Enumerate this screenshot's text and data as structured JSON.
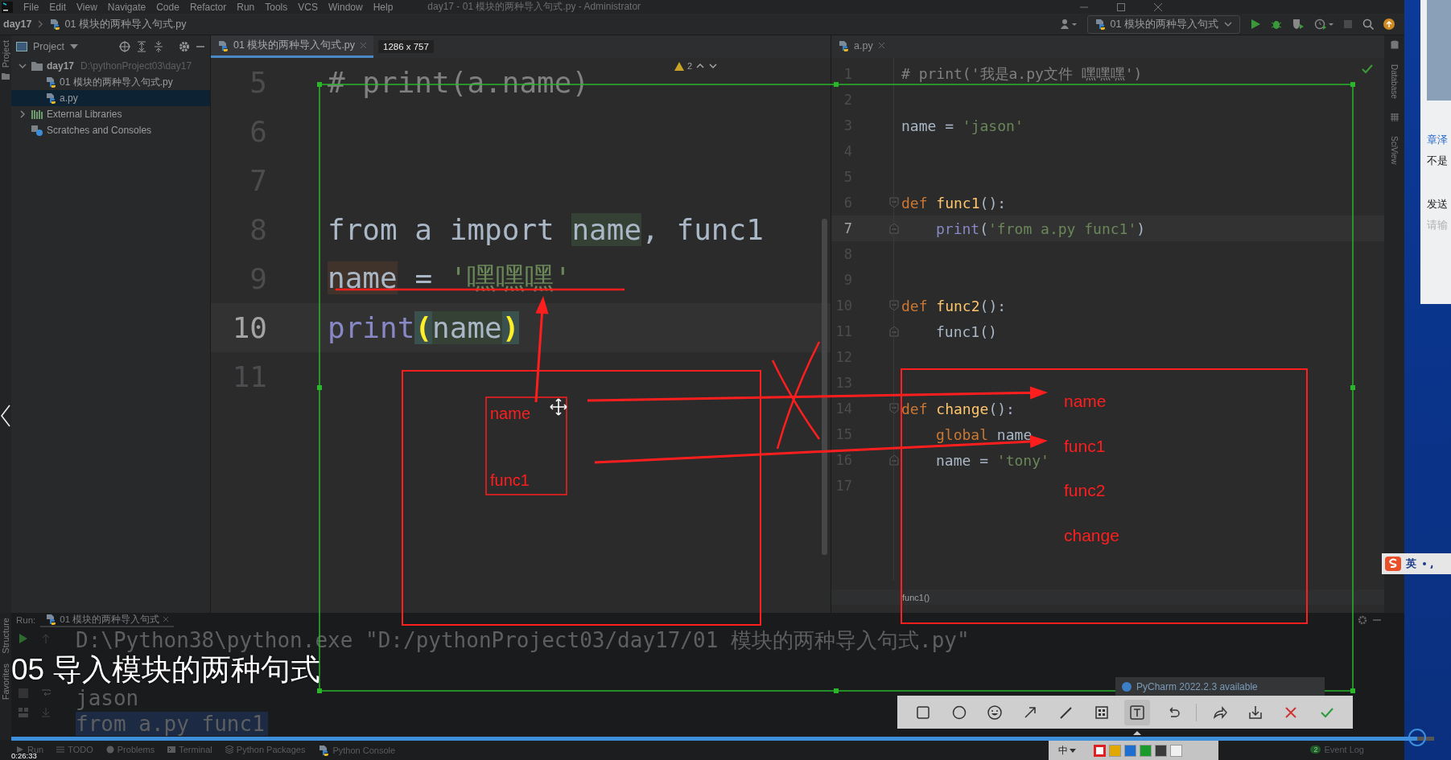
{
  "title_bar": {
    "menu": [
      "File",
      "Edit",
      "View",
      "Navigate",
      "Code",
      "Refactor",
      "Run",
      "Tools",
      "VCS",
      "Window",
      "Help"
    ],
    "title": "day17 - 01 模块的两种导入句式.py - Administrator"
  },
  "nav_bar": {
    "breadcrumbs": [
      "day17",
      "01 模块的两种导入句式.py"
    ],
    "run_config": "01 模块的两种导入句式"
  },
  "left_stripe": {
    "top": [
      "Project"
    ],
    "bottom": [
      "Structure",
      "Favorites"
    ]
  },
  "project_panel": {
    "title": "Project",
    "tree": [
      {
        "label": "day17",
        "path": "D:\\pythonProject03\\day17",
        "kind": "folder",
        "expanded": true,
        "selected": false,
        "children": [
          {
            "label": "01 模块的两种导入句式.py",
            "kind": "python",
            "selected": false
          },
          {
            "label": "a.py",
            "kind": "python",
            "selected": true
          }
        ]
      },
      {
        "label": "External Libraries",
        "kind": "library",
        "expanded": false,
        "selected": false
      },
      {
        "label": "Scratches and Consoles",
        "kind": "scratches",
        "selected": false
      }
    ]
  },
  "left_editor": {
    "tab": {
      "label": "01 模块的两种导入句式.py",
      "selected": true
    },
    "warnings": "2",
    "lines": [
      {
        "number": "5",
        "current": false,
        "tokens": [
          {
            "text": "# print(a.name)",
            "kind": "comment"
          }
        ]
      },
      {
        "number": "6",
        "current": false
      },
      {
        "number": "7",
        "current": false
      },
      {
        "number": "8",
        "current": false,
        "tokens": [
          {
            "text": "from a import ",
            "kind": "plain"
          },
          {
            "text": "name",
            "kind": "usage"
          },
          {
            "text": ", func1",
            "kind": "plain"
          }
        ]
      },
      {
        "number": "9",
        "current": false,
        "tokens": [
          {
            "text": "name",
            "kind": "assignment"
          },
          {
            "text": " = ",
            "kind": "plain"
          },
          {
            "text": "'嘿嘿嘿'",
            "kind": "string"
          }
        ]
      },
      {
        "number": "10",
        "current": true,
        "tokens": [
          {
            "text": "print",
            "kind": "builtin"
          },
          {
            "text": "(",
            "kind": "matched_paren"
          },
          {
            "text": "name",
            "kind": "usage"
          },
          {
            "text": ")",
            "kind": "matched_paren"
          }
        ]
      },
      {
        "number": "11",
        "current": false
      }
    ]
  },
  "right_editor": {
    "tab": {
      "label": "a.py",
      "selected": false
    },
    "breadcrumb": "func1()",
    "lines": [
      {
        "number": "1",
        "current": false,
        "tokens": [
          {
            "text": "# print('我是a.py文件 嘿嘿嘿')",
            "kind": "comment"
          }
        ]
      },
      {
        "number": "2",
        "current": false
      },
      {
        "number": "3",
        "current": false,
        "tokens": [
          {
            "text": "name = ",
            "kind": "plain"
          },
          {
            "text": "'jason'",
            "kind": "string"
          }
        ]
      },
      {
        "number": "4",
        "current": false
      },
      {
        "number": "5",
        "current": false
      },
      {
        "number": "6",
        "current": false,
        "kind": "fold_start",
        "tokens": [
          {
            "text": "def ",
            "kind": "keyword"
          },
          {
            "text": "func1",
            "kind": "function"
          },
          {
            "text": "():",
            "kind": "plain"
          }
        ]
      },
      {
        "number": "7",
        "current": true,
        "kind": "fold_end",
        "indented": true,
        "tokens": [
          {
            "text": "print",
            "kind": "builtin"
          },
          {
            "text": "(",
            "kind": "plain"
          },
          {
            "text": "'from a.py func1'",
            "kind": "string"
          },
          {
            "text": ")",
            "kind": "plain"
          }
        ]
      },
      {
        "number": "8",
        "current": false
      },
      {
        "number": "9",
        "current": false
      },
      {
        "number": "10",
        "current": false,
        "kind": "fold_start",
        "tokens": [
          {
            "text": "def ",
            "kind": "keyword"
          },
          {
            "text": "func2",
            "kind": "function"
          },
          {
            "text": "():",
            "kind": "plain"
          }
        ]
      },
      {
        "number": "11",
        "current": false,
        "kind": "fold_end",
        "indented": true,
        "tokens": [
          {
            "text": "func1()",
            "kind": "plain"
          }
        ]
      },
      {
        "number": "12",
        "current": false
      },
      {
        "number": "13",
        "current": false
      },
      {
        "number": "14",
        "current": false,
        "kind": "fold_start",
        "tokens": [
          {
            "text": "def ",
            "kind": "keyword"
          },
          {
            "text": "change",
            "kind": "function"
          },
          {
            "text": "():",
            "kind": "plain"
          }
        ]
      },
      {
        "number": "15",
        "current": false,
        "indented": true,
        "tokens": [
          {
            "text": "global",
            "kind": "keyword"
          },
          {
            "text": " name",
            "kind": "plain"
          }
        ]
      },
      {
        "number": "16",
        "current": false,
        "kind": "fold_end",
        "indented": true,
        "tokens": [
          {
            "text": "name = ",
            "kind": "plain"
          },
          {
            "text": "'tony'",
            "kind": "string"
          }
        ]
      },
      {
        "number": "17",
        "current": false
      }
    ]
  },
  "right_stripe": [
    "Database",
    "SciView"
  ],
  "chat_panel": [
    {
      "text": "章泽",
      "kind": "name"
    },
    {
      "text": "不是",
      "kind": "message"
    },
    {
      "text": "发送",
      "kind": "button"
    },
    {
      "text": "请输",
      "kind": "hint"
    }
  ],
  "ime_bar": {
    "label": "英"
  },
  "run_panel": {
    "label": "Run:",
    "tab": "01 模块的两种导入句式",
    "output": [
      {
        "text": "D:\\Python38\\python.exe \"D:/pythonProject03/day17/01 模块的两种导入句式.py\"",
        "selected": false
      },
      {
        "text": "jason",
        "selected": false
      },
      {
        "text": "from a.py func1",
        "selected": true
      }
    ]
  },
  "notification": "PyCharm 2022.2.3 available",
  "subtitle": "05 导入模块的两种句式",
  "tool_bar": [
    {
      "label": "Run",
      "kind": "run"
    },
    {
      "label": "TODO",
      "kind": "todo"
    },
    {
      "label": "Problems",
      "kind": "problems"
    },
    {
      "label": "Terminal",
      "kind": "terminal"
    },
    {
      "label": "Python Packages",
      "kind": "packages"
    },
    {
      "label": "Python Console",
      "kind": "console"
    }
  ],
  "event_log": {
    "count": "2",
    "label": "Event Log"
  },
  "player": {
    "time": "0:26:33",
    "level": 0.988
  },
  "capture": {
    "size": "1286 x 757",
    "font_size": "中",
    "tools": [
      {
        "kind": "rectangle",
        "selected": false
      },
      {
        "kind": "ellipse",
        "selected": false
      },
      {
        "kind": "emoji",
        "selected": false
      },
      {
        "kind": "arrow",
        "selected": false
      },
      {
        "kind": "pen",
        "selected": false
      },
      {
        "kind": "mosaic",
        "selected": false
      },
      {
        "kind": "text",
        "selected": true
      },
      {
        "kind": "undo",
        "selected": false
      },
      {
        "kind": "redo",
        "selected": false
      },
      {
        "kind": "save",
        "selected": false
      },
      {
        "kind": "cancel",
        "selected": false
      },
      {
        "kind": "confirm",
        "selected": false
      }
    ],
    "colors": [
      {
        "color": "#e02020",
        "selected": true
      },
      {
        "color": "#e0a800",
        "selected": false
      },
      {
        "color": "#1e6fd0",
        "selected": false
      },
      {
        "color": "#1a9a2a",
        "selected": false
      },
      {
        "color": "#3a3a3a",
        "selected": false
      },
      {
        "color": "#f0f0f0",
        "selected": false
      }
    ]
  },
  "annotations": {
    "left_labels": [
      "name",
      "func1"
    ],
    "right_labels": [
      "name",
      "func1",
      "func2",
      "change"
    ]
  }
}
